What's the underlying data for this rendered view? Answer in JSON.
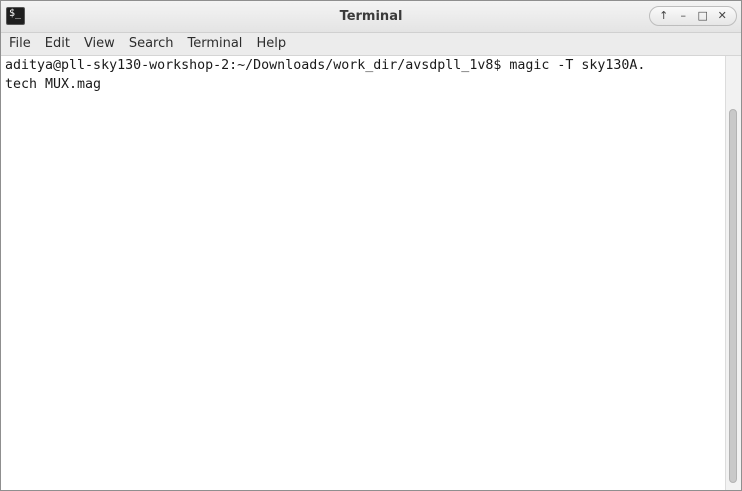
{
  "window": {
    "title": "Terminal",
    "app_icon_glyph": "$_",
    "controls": {
      "up_icon": "↑",
      "minimize_icon": "–",
      "maximize_icon": "□",
      "close_icon": "✕"
    }
  },
  "menubar": {
    "items": [
      "File",
      "Edit",
      "View",
      "Search",
      "Terminal",
      "Help"
    ]
  },
  "terminal": {
    "lines": [
      "aditya@pll-sky130-workshop-2:~/Downloads/work_dir/avsdpll_1v8$ magic -T sky130A.",
      "tech MUX.mag"
    ]
  },
  "colors": {
    "background": "#ffffff",
    "text": "#1a1a1a",
    "titlebar": "#ececec"
  }
}
